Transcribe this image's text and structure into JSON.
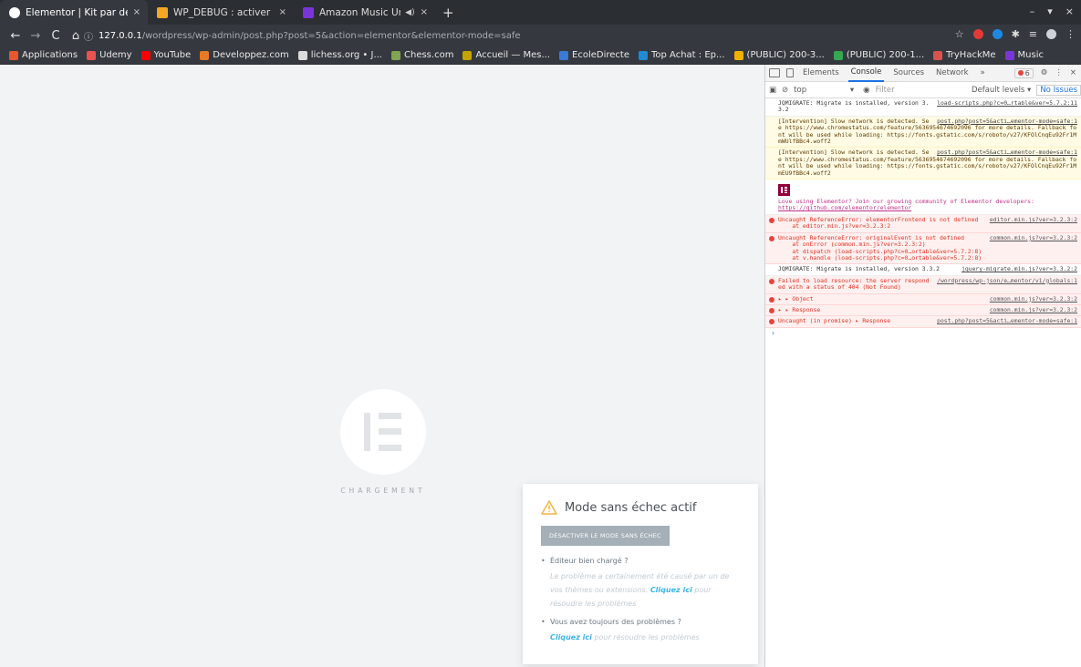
{
  "tabs": [
    {
      "title": "Elementor | Kit par défaut",
      "color": "#ffffff",
      "close": "×"
    },
    {
      "title": "WP_DEBUG : activer les lo",
      "color": "#f5a623",
      "close": "×"
    },
    {
      "title": "Amazon Music Unlimi",
      "color": "#7a35d8",
      "close": "×",
      "sound": "◀)"
    }
  ],
  "new_tab": "+",
  "window_controls": {
    "min": "–",
    "max": "▾",
    "close": "×"
  },
  "nav": {
    "back": "←",
    "forward": "→",
    "reload": "C",
    "home": "⌂"
  },
  "address": {
    "info": "ⓘ",
    "host": "127.0.0.1",
    "path": "/wordpress/wp-admin/post.php?post=5&action=elementor&elementor-mode=safe"
  },
  "bookmarks": [
    {
      "label": "Applications",
      "color": "#e8572e"
    },
    {
      "label": "Udemy",
      "color": "#ec5252"
    },
    {
      "label": "YouTube",
      "color": "#ff0000"
    },
    {
      "label": "Developpez.com",
      "color": "#e57a27"
    },
    {
      "label": "lichess.org • J...",
      "color": "#dcdcdc"
    },
    {
      "label": "Chess.com",
      "color": "#7fa650"
    },
    {
      "label": "Accueil — Mes...",
      "color": "#c5a400"
    },
    {
      "label": "EcoleDirecte",
      "color": "#3a7bd5"
    },
    {
      "label": "Top Achat : Ep...",
      "color": "#1f8ad6"
    },
    {
      "label": "(PUBLIC) 200-3...",
      "color": "#f2b100"
    },
    {
      "label": "(PUBLIC) 200-1...",
      "color": "#34a853"
    },
    {
      "label": "TryHackMe",
      "color": "#d9534f"
    },
    {
      "label": "Music",
      "color": "#7a35d8"
    }
  ],
  "loader": {
    "text": "CHARGEMENT"
  },
  "safe_mode": {
    "title": "Mode sans échec actif",
    "deactivate": "DÉSACTIVER LE MODE SANS ÉCHEC",
    "q1": "Éditeur bien chargé ?",
    "a1_pre": "Le problème a certainement été causé par un de vos thèmes ou extensions.",
    "a1_link": "Cliquez ici",
    "a1_post": "pour résoudre les problèmes",
    "q2": "Vous avez toujours des problèmes ?",
    "a2_link": "Cliquez ici",
    "a2_post": "pour résoudre les problèmes"
  },
  "devtools": {
    "tabs": [
      "Elements",
      "Console",
      "Sources",
      "Network",
      "»"
    ],
    "error_count": "6",
    "context": "top",
    "filter_placeholder": "Filter",
    "levels": "Default levels ▾",
    "issues": "No Issues",
    "messages": [
      {
        "type": "log",
        "text": "JQMIGRATE: Migrate is installed, version 3.3.2",
        "src": "load-scripts.php?c=0…rtable&ver=5.7.2:11"
      },
      {
        "type": "warn",
        "text": "[Intervention] Slow network is detected. See https://www.chromestatus.com/feature/5636954674692096 for more details. Fallback font will be used while loading: https://fonts.gstatic.com/s/roboto/v27/KFOlCnqEu92Fr1MmWUlfBBc4.woff2",
        "src": "post.php?post=5&acti…ementor-mode=safe:1"
      },
      {
        "type": "warn",
        "text": "[Intervention] Slow network is detected. See https://www.chromestatus.com/feature/5636954674692096 for more details. Fallback font will be used while loading: https://fonts.gstatic.com/s/roboto/v27/KFOlCnqEu92Fr1MmEU9fBBc4.woff2",
        "src": "post.php?post=5&acti…ementor-mode=safe:1"
      },
      {
        "type": "error",
        "text": "Uncaught ReferenceError: elementorFrontend is not defined\n    at editor.min.js?ver=3.2.3:2",
        "src": "editor.min.js?ver=3.2.3:2"
      },
      {
        "type": "error",
        "text": "Uncaught ReferenceError: originalEvent is not defined\n    at onError (common.min.js?ver=3.2.3:2)\n    at dispatch (load-scripts.php?c=0…ortable&ver=5.7.2:8)\n    at v.handle (load-scripts.php?c=0…ortable&ver=5.7.2:8)",
        "src": "common.min.js?ver=3.2.3:2"
      },
      {
        "type": "log",
        "text": "JQMIGRATE: Migrate is installed, version 3.3.2",
        "src": "jquery-migrate.min.js?ver=3.3.2:2"
      },
      {
        "type": "error",
        "text": "Failed to load resource: the server responded with a status of 404 (Not Found)",
        "src": "/wordpress/wp-json/e…mentor/v1/globals:1"
      },
      {
        "type": "error",
        "text": "▸ ▸ Object",
        "src": "common.min.js?ver=3.2.3:2"
      },
      {
        "type": "error",
        "text": "▸ ▸ Response",
        "src": "common.min.js?ver=3.2.3:2"
      },
      {
        "type": "error",
        "text": "Uncaught (in promise) ▸ Response",
        "src": "post.php?post=5&acti…ementor-mode=safe:1"
      }
    ],
    "promo_text": "Love using Elementor? Join our growing community of Elementor developers:",
    "promo_link": "https://github.com/elementor/elementor",
    "prompt": "›"
  }
}
